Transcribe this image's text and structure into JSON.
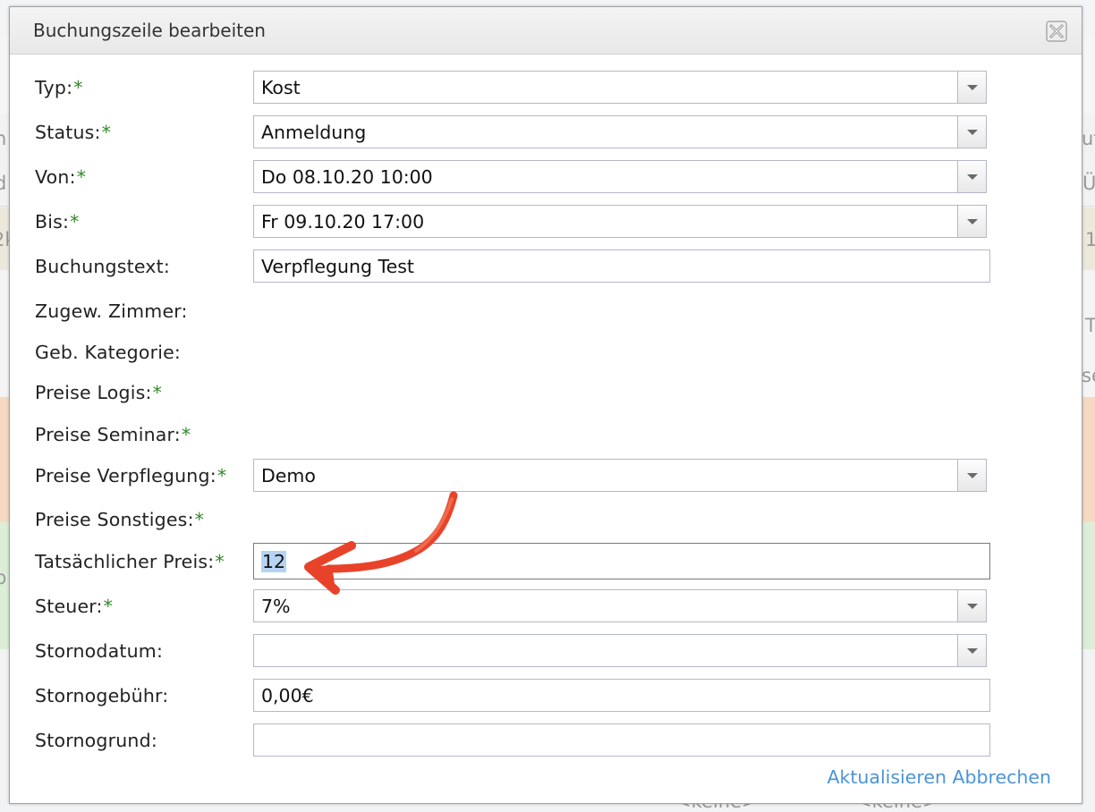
{
  "background": {
    "left_glyphs": [
      "n",
      "d",
      "2k",
      "p"
    ],
    "right_glyphs": [
      "ut",
      "Ü",
      "1",
      "T",
      "se"
    ],
    "bottom_cells": [
      "<keine>",
      "<keine>"
    ]
  },
  "dialog": {
    "title": "Buchungszeile bearbeiten",
    "close_icon": "close-icon",
    "required_marker": "*",
    "fields": {
      "typ": {
        "label": "Typ:",
        "value": "Kost"
      },
      "status": {
        "label": "Status:",
        "value": "Anmeldung"
      },
      "von": {
        "label": "Von:",
        "value": "Do 08.10.20 10:00"
      },
      "bis": {
        "label": "Bis:",
        "value": "Fr 09.10.20 17:00"
      },
      "buchungstext": {
        "label": "Buchungstext:",
        "value": "Verpflegung Test"
      },
      "zugew_zimmer": {
        "label": "Zugew. Zimmer:"
      },
      "geb_kategorie": {
        "label": "Geb. Kategorie:"
      },
      "preise_logis": {
        "label": "Preise Logis:"
      },
      "preise_seminar": {
        "label": "Preise Seminar:"
      },
      "preise_verpflegung": {
        "label": "Preise Verpflegung:",
        "value": "Demo"
      },
      "preise_sonstiges": {
        "label": "Preise Sonstiges:"
      },
      "tatsaechlicher_preis": {
        "label": "Tatsächlicher Preis:",
        "value": "12"
      },
      "steuer": {
        "label": "Steuer:",
        "value": "7%"
      },
      "stornodatum": {
        "label": "Stornodatum:",
        "value": ""
      },
      "stornogebuehr": {
        "label": "Stornogebühr:",
        "value": "0,00€"
      },
      "stornogrund": {
        "label": "Stornogrund:",
        "value": ""
      }
    },
    "actions": {
      "update": "Aktualisieren",
      "cancel": "Abbrechen"
    }
  },
  "colors": {
    "required": "#2f8a25",
    "link": "#4c94d8",
    "selection": "#b5d3f3",
    "annotation_arrow": "#e8432a"
  }
}
